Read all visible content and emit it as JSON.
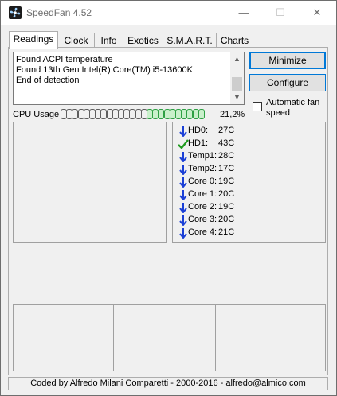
{
  "window": {
    "title": "SpeedFan 4.52",
    "minimize_glyph": "—",
    "maximize_glyph": "☐",
    "close_glyph": "✕"
  },
  "tabs": [
    {
      "label": "Readings",
      "active": true
    },
    {
      "label": "Clock"
    },
    {
      "label": "Info"
    },
    {
      "label": "Exotics"
    },
    {
      "label": "S.M.A.R.T."
    },
    {
      "label": "Charts"
    }
  ],
  "log": {
    "lines": [
      "Found ACPI temperature",
      "Found 13th Gen Intel(R) Core(TM) i5-13600K",
      "End of detection"
    ],
    "scroll_up_icon": "▲",
    "scroll_down_icon": "▼"
  },
  "buttons": {
    "minimize": "Minimize",
    "configure": "Configure"
  },
  "auto_fan": {
    "label": "Automatic fan speed",
    "checked": false
  },
  "cpu": {
    "label": "CPU Usage",
    "percent_text": "21,2%",
    "segments_total": 25,
    "segments_on": 10
  },
  "temperatures": [
    {
      "name": "HD0:",
      "value": "27C",
      "icon": "arrow-down-icon"
    },
    {
      "name": "HD1:",
      "value": "43C",
      "icon": "check-icon"
    },
    {
      "name": "Temp1:",
      "value": "28C",
      "icon": "arrow-down-icon"
    },
    {
      "name": "Temp2:",
      "value": "17C",
      "icon": "arrow-down-icon"
    },
    {
      "name": "Core 0:",
      "value": "19C",
      "icon": "arrow-down-icon"
    },
    {
      "name": "Core 1:",
      "value": "20C",
      "icon": "arrow-down-icon"
    },
    {
      "name": "Core 2:",
      "value": "19C",
      "icon": "arrow-down-icon"
    },
    {
      "name": "Core 3:",
      "value": "20C",
      "icon": "arrow-down-icon"
    },
    {
      "name": "Core 4:",
      "value": "21C",
      "icon": "arrow-down-icon"
    }
  ],
  "status": {
    "text": "Coded by Alfredo Milani Comparetti - 2000-2016 - alfredo@almico.com"
  },
  "colors": {
    "arrow_blue": "#1a3fd6",
    "check_green": "#1f9a1f",
    "cpu_on": "#2ea043",
    "accent": "#0078d7"
  }
}
